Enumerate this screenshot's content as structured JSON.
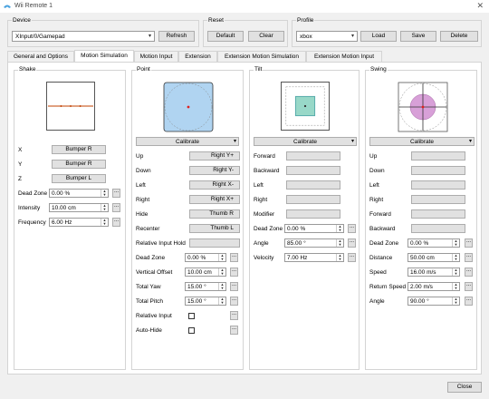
{
  "window": {
    "title": "Wii Remote 1",
    "close_glyph": "✕"
  },
  "device": {
    "label": "Device",
    "selected": "XInput/0/Gamepad",
    "refresh": "Refresh"
  },
  "reset": {
    "label": "Reset",
    "default": "Default",
    "clear": "Clear"
  },
  "profile": {
    "label": "Profile",
    "selected": "xbox",
    "load": "Load",
    "save": "Save",
    "delete": "Delete"
  },
  "tabs": [
    {
      "label": "General and Options"
    },
    {
      "label": "Motion Simulation"
    },
    {
      "label": "Motion Input"
    },
    {
      "label": "Extension"
    },
    {
      "label": "Extension Motion Simulation"
    },
    {
      "label": "Extension Motion Input"
    }
  ],
  "shake": {
    "title": "Shake",
    "x_label": "X",
    "x_value": "Bumper R",
    "y_label": "Y",
    "y_value": "Bumper R",
    "z_label": "Z",
    "z_value": "Bumper L",
    "deadzone_label": "Dead Zone",
    "deadzone_value": "0.00 %",
    "intensity_label": "Intensity",
    "intensity_value": "10.00 cm",
    "frequency_label": "Frequency",
    "frequency_value": "6.00 Hz"
  },
  "point": {
    "title": "Point",
    "calibrate": "Calibrate",
    "up_label": "Up",
    "up_value": "Right Y+",
    "down_label": "Down",
    "down_value": "Right Y-",
    "left_label": "Left",
    "left_value": "Right X-",
    "right_label": "Right",
    "right_value": "Right X+",
    "hide_label": "Hide",
    "hide_value": "Thumb R",
    "recenter_label": "Recenter",
    "recenter_value": "Thumb L",
    "relhold_label": "Relative Input Hold",
    "relhold_value": "",
    "deadzone_label": "Dead Zone",
    "deadzone_value": "0.00 %",
    "voffset_label": "Vertical Offset",
    "voffset_value": "10.00 cm",
    "yaw_label": "Total Yaw",
    "yaw_value": "15.00 °",
    "pitch_label": "Total Pitch",
    "pitch_value": "15.00 °",
    "relinput_label": "Relative Input",
    "autohide_label": "Auto-Hide"
  },
  "tilt": {
    "title": "Tilt",
    "calibrate": "Calibrate",
    "forward_label": "Forward",
    "backward_label": "Backward",
    "left_label": "Left",
    "right_label": "Right",
    "modifier_label": "Modifier",
    "deadzone_label": "Dead Zone",
    "deadzone_value": "0.00 %",
    "angle_label": "Angle",
    "angle_value": "85.00 °",
    "velocity_label": "Velocity",
    "velocity_value": "7.00 Hz"
  },
  "swing": {
    "title": "Swing",
    "calibrate": "Calibrate",
    "up_label": "Up",
    "down_label": "Down",
    "left_label": "Left",
    "right_label": "Right",
    "forward_label": "Forward",
    "backward_label": "Backward",
    "deadzone_label": "Dead Zone",
    "deadzone_value": "0.00 %",
    "distance_label": "Distance",
    "distance_value": "50.00 cm",
    "speed_label": "Speed",
    "speed_value": "16.00 m/s",
    "retspeed_label": "Return Speed",
    "retspeed_value": "2.00 m/s",
    "angle_label": "Angle",
    "angle_value": "90.00 °"
  },
  "footer": {
    "close": "Close"
  },
  "glyphs": {
    "dropdown": "▾",
    "spin_up": "▲",
    "spin_down": "▼",
    "more": "..."
  },
  "colors": {
    "point_fill": "#b0d4f1",
    "tilt_fill": "#98d8c8",
    "swing_fill": "#d8a0d8",
    "marker": "#e02020",
    "shake_line": "#c04000"
  }
}
